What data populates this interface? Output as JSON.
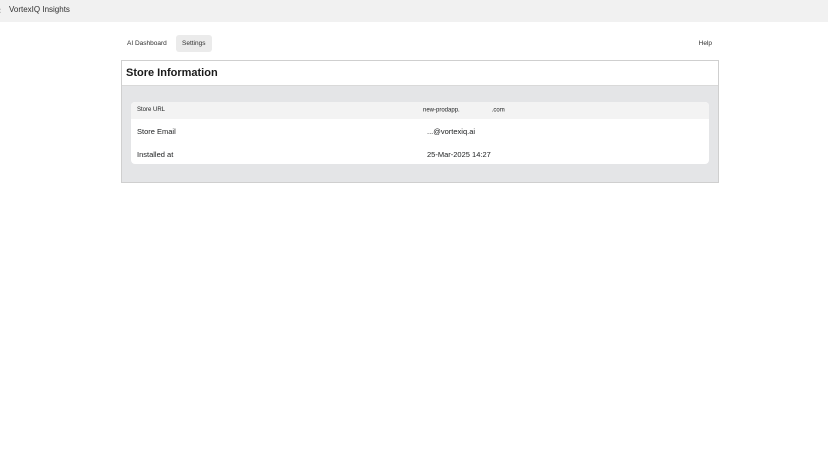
{
  "app": {
    "title": "VortexIQ Insights"
  },
  "nav": {
    "tabs": [
      {
        "label": "AI Dashboard"
      },
      {
        "label": "Settings"
      }
    ],
    "help_label": "Help"
  },
  "store_info": {
    "title": "Store Information",
    "rows": [
      {
        "key": "Store URL",
        "value_prefix": "new-prodapp.",
        "value_suffix": ".com"
      },
      {
        "key": "Store Email",
        "value": "...@vortexiq.ai"
      },
      {
        "key": "Installed at",
        "value": "25-Mar-2025 14:27"
      }
    ]
  },
  "colors": {
    "topbar": "#f1f1f1",
    "card_bg": "#e4e5e7",
    "selected_tab": "#ebebeb"
  }
}
